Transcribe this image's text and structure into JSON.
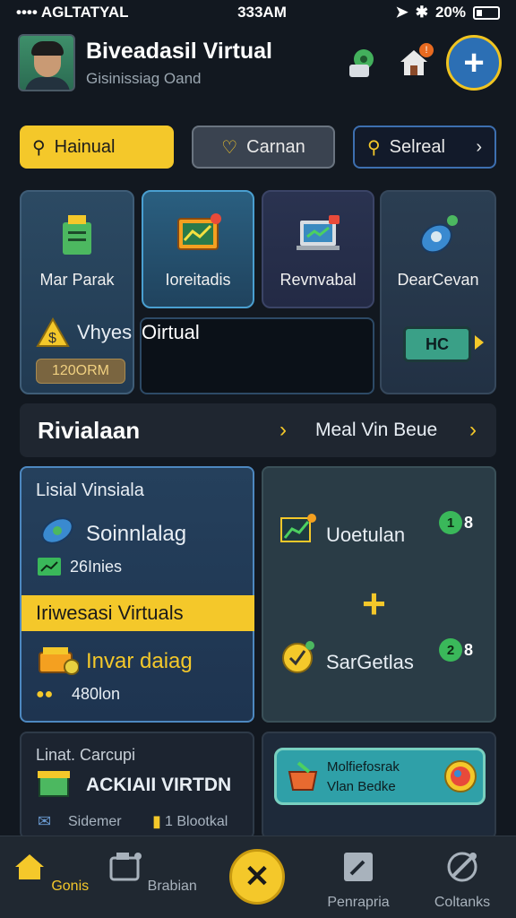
{
  "status_bar": {
    "carrier": "•••• AGLTATYAL",
    "time": "333AM",
    "battery": "20%"
  },
  "header": {
    "title": "Biveadasil Virtual",
    "subtitle": "Gisinissiag Oand",
    "notification_count": "!"
  },
  "chips": [
    {
      "label": "Hainual"
    },
    {
      "label": "Carnan"
    },
    {
      "label": "Selreal"
    }
  ],
  "tiles": {
    "a": {
      "label": "Mar Parak"
    },
    "b": {
      "label": "Ioreitadis"
    },
    "c": {
      "label": "Revnvabal"
    },
    "d": {
      "label": "DearCevan"
    },
    "vhyes": "Vhyes",
    "oirtual": "Oirtual",
    "code": "120ORM",
    "hc": "HC"
  },
  "banner": {
    "left": "Rivialaan",
    "right": "Meal Vin Beue"
  },
  "card_left": {
    "title": "Lisial Vinsiala",
    "item1": "Soinnlalag",
    "item1_sub": "26Inies",
    "highlight": "Iriwesasi Virtuals",
    "item2": "Invar daiag",
    "item2_sub": "480lon"
  },
  "card_right": {
    "item1": "Uoetulan",
    "item1_badge": "8",
    "item1_dot": "1",
    "plus": "+",
    "item2": "SarGetlas",
    "item2_badge": "8",
    "item2_dot": "2"
  },
  "card_bottom_left": {
    "title": "Linat. Carcupi",
    "main": "ACKIAII VIRTDN",
    "sub_left": "Sidemer",
    "sub_right": "1 Blootkal"
  },
  "card_bottom_right": {
    "line1": "Molfiefosrak",
    "line2": "Vlan Bedke"
  },
  "tabbar": {
    "items": [
      {
        "label": "Gonis"
      },
      {
        "label": "Brabian"
      },
      {
        "label": "Penrapria"
      },
      {
        "label": "Coltanks"
      }
    ],
    "center": "✕"
  },
  "colors": {
    "accent": "#f4c82a",
    "bg": "#121820",
    "blue": "#2c6fb4"
  }
}
